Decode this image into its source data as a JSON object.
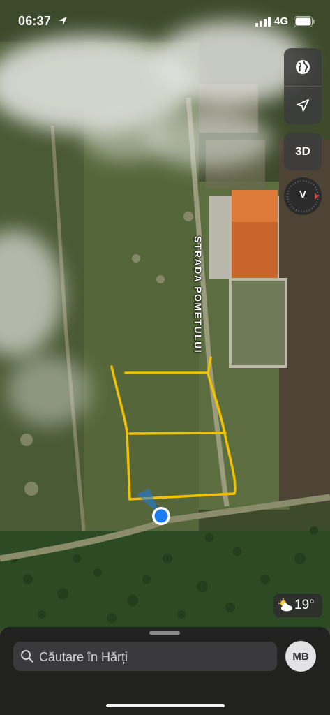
{
  "status_bar": {
    "time": "06:37",
    "network": "4G",
    "icons": [
      "location-arrow-icon",
      "cellular-signal-icon",
      "battery-icon"
    ]
  },
  "map": {
    "street_label": "STRADA POMETULUI",
    "markup_color": "#f2c200",
    "user_location_color": "#1a7cf0",
    "map_type": "satellite"
  },
  "controls": {
    "map_mode_icon": "globe-icon",
    "tracking_icon": "location-arrow-icon",
    "threed_label": "3D",
    "compass_label": "V"
  },
  "weather": {
    "icon": "partly-cloudy-icon",
    "temperature": "19°"
  },
  "bottom_sheet": {
    "search_placeholder": "Căutare în Hărți",
    "avatar_initials": "MB"
  }
}
